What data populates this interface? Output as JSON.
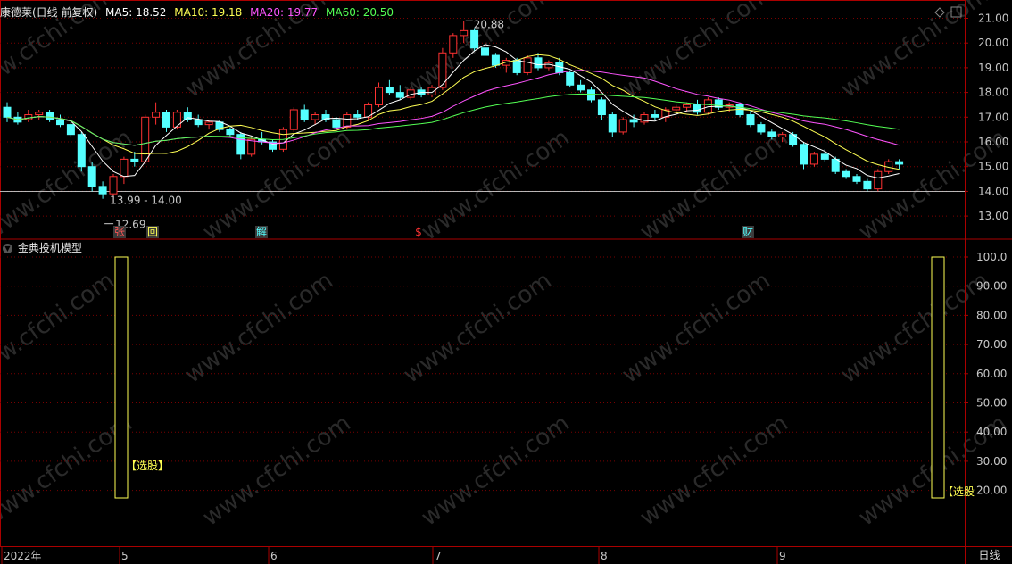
{
  "stock": {
    "title": "康德莱(日线 前复权)",
    "ma": [
      {
        "label": "MA5: 18.52",
        "color": "#ffffff"
      },
      {
        "label": "MA10: 19.18",
        "color": "#ffff54"
      },
      {
        "label": "MA20: 19.77",
        "color": "#ff54ff"
      },
      {
        "label": "MA60: 20.50",
        "color": "#54ff54"
      }
    ]
  },
  "indicator": {
    "title": "金典投机模型",
    "signal_label": "【选股】",
    "signal_label_right": "【选股"
  },
  "price_axis": {
    "ticks": [
      "21.00",
      "20.00",
      "19.00",
      "18.00",
      "17.00",
      "16.00",
      "15.00",
      "14.00",
      "13.00"
    ]
  },
  "indicator_axis": {
    "ticks": [
      "100.0",
      "90.00",
      "80.00",
      "70.00",
      "60.00",
      "50.00",
      "40.00",
      "30.00",
      "20.00"
    ]
  },
  "annotations": {
    "high": "20.88",
    "low": "12.69",
    "band": "13.99 - 14.00"
  },
  "markers": [
    {
      "label": "张",
      "color": "#ff5555",
      "bg": "#3a3a3a"
    },
    {
      "label": "回",
      "color": "#ffff54",
      "bg": "#3a3a3a"
    },
    {
      "label": "解",
      "color": "#54ffff",
      "bg": "#3a3a3a"
    },
    {
      "label": "$",
      "color": "#ff3333",
      "bg": "none"
    },
    {
      "label": "财",
      "color": "#54ffff",
      "bg": "#3a3a3a"
    }
  ],
  "time_axis": {
    "labels": [
      "2022年",
      "5",
      "6",
      "7",
      "8",
      "9"
    ],
    "period_tab": "日线"
  },
  "watermark": "www.cfchi.com",
  "colors": {
    "up": "#ff3232",
    "down": "#54ffff",
    "grid": "#7a0000",
    "border": "#aa0000",
    "axis_text": "#c8c8c8"
  },
  "chart_data": {
    "type": "candlestick",
    "ylim": [
      12.2,
      21.4
    ],
    "candles": [
      [
        17.4,
        17.6,
        16.8,
        17.0
      ],
      [
        17.0,
        17.2,
        16.7,
        16.8
      ],
      [
        16.9,
        17.3,
        16.8,
        17.1
      ],
      [
        17.1,
        17.3,
        16.9,
        17.2
      ],
      [
        17.2,
        17.3,
        16.8,
        16.9
      ],
      [
        16.9,
        17.1,
        16.6,
        16.7
      ],
      [
        16.7,
        16.8,
        16.2,
        16.3
      ],
      [
        16.3,
        16.4,
        14.8,
        15.0
      ],
      [
        15.0,
        15.2,
        14.0,
        14.2
      ],
      [
        14.2,
        14.4,
        13.7,
        13.9
      ],
      [
        13.9,
        14.7,
        13.5,
        14.6
      ],
      [
        14.6,
        15.4,
        14.3,
        15.3
      ],
      [
        15.3,
        15.6,
        15.0,
        15.2
      ],
      [
        15.2,
        17.1,
        15.1,
        17.0
      ],
      [
        17.0,
        17.6,
        16.7,
        17.2
      ],
      [
        17.2,
        17.3,
        16.4,
        16.6
      ],
      [
        16.6,
        17.3,
        16.5,
        17.2
      ],
      [
        17.2,
        17.4,
        16.8,
        16.9
      ],
      [
        16.9,
        17.1,
        16.6,
        16.7
      ],
      [
        16.7,
        16.9,
        16.5,
        16.8
      ],
      [
        16.8,
        16.9,
        16.4,
        16.5
      ],
      [
        16.5,
        16.6,
        16.2,
        16.3
      ],
      [
        16.3,
        16.4,
        15.3,
        15.5
      ],
      [
        15.5,
        16.2,
        15.4,
        16.1
      ],
      [
        16.1,
        16.4,
        15.9,
        16.0
      ],
      [
        16.0,
        16.1,
        15.6,
        15.7
      ],
      [
        15.7,
        16.6,
        15.6,
        16.5
      ],
      [
        16.5,
        17.4,
        16.4,
        17.3
      ],
      [
        17.3,
        17.5,
        16.8,
        16.9
      ],
      [
        16.9,
        17.2,
        16.7,
        17.1
      ],
      [
        17.1,
        17.3,
        16.8,
        16.9
      ],
      [
        16.9,
        17.0,
        16.5,
        16.6
      ],
      [
        16.6,
        17.2,
        16.5,
        17.1
      ],
      [
        17.1,
        17.3,
        16.9,
        17.0
      ],
      [
        17.0,
        17.6,
        16.9,
        17.5
      ],
      [
        17.5,
        18.4,
        17.4,
        18.2
      ],
      [
        18.2,
        18.5,
        17.9,
        18.0
      ],
      [
        18.0,
        18.3,
        17.7,
        17.8
      ],
      [
        17.8,
        18.2,
        17.7,
        18.1
      ],
      [
        18.1,
        18.2,
        17.8,
        17.9
      ],
      [
        17.9,
        18.3,
        17.8,
        18.2
      ],
      [
        18.2,
        19.8,
        18.1,
        19.6
      ],
      [
        19.6,
        20.4,
        19.4,
        20.3
      ],
      [
        20.3,
        20.9,
        20.0,
        20.5
      ],
      [
        20.5,
        20.6,
        19.7,
        19.8
      ],
      [
        19.8,
        20.0,
        19.3,
        19.5
      ],
      [
        19.5,
        19.6,
        19.0,
        19.1
      ],
      [
        19.1,
        19.4,
        18.8,
        19.3
      ],
      [
        19.3,
        19.4,
        18.7,
        18.8
      ],
      [
        18.8,
        19.5,
        18.7,
        19.4
      ],
      [
        19.4,
        19.6,
        18.9,
        19.0
      ],
      [
        19.0,
        19.3,
        18.9,
        19.2
      ],
      [
        19.2,
        19.4,
        18.7,
        18.8
      ],
      [
        18.8,
        18.9,
        18.2,
        18.3
      ],
      [
        18.3,
        18.5,
        18.0,
        18.1
      ],
      [
        18.1,
        18.2,
        17.6,
        17.7
      ],
      [
        17.7,
        17.8,
        16.9,
        17.1
      ],
      [
        17.1,
        17.2,
        16.2,
        16.4
      ],
      [
        16.4,
        17.0,
        16.3,
        16.9
      ],
      [
        16.9,
        17.1,
        16.6,
        16.8
      ],
      [
        16.8,
        17.2,
        16.7,
        17.1
      ],
      [
        17.1,
        17.3,
        16.9,
        17.0
      ],
      [
        17.0,
        17.4,
        16.8,
        17.3
      ],
      [
        17.3,
        17.5,
        17.1,
        17.4
      ],
      [
        17.4,
        17.6,
        17.2,
        17.5
      ],
      [
        17.5,
        17.7,
        17.1,
        17.2
      ],
      [
        17.2,
        17.8,
        17.1,
        17.7
      ],
      [
        17.7,
        17.8,
        17.3,
        17.4
      ],
      [
        17.4,
        17.6,
        17.2,
        17.5
      ],
      [
        17.5,
        17.6,
        17.0,
        17.1
      ],
      [
        17.1,
        17.3,
        16.6,
        16.7
      ],
      [
        16.7,
        16.8,
        16.3,
        16.4
      ],
      [
        16.4,
        16.5,
        16.1,
        16.2
      ],
      [
        16.2,
        16.4,
        16.0,
        16.3
      ],
      [
        16.3,
        16.4,
        15.8,
        15.9
      ],
      [
        15.9,
        16.0,
        14.9,
        15.1
      ],
      [
        15.1,
        15.6,
        15.0,
        15.5
      ],
      [
        15.5,
        15.7,
        15.2,
        15.3
      ],
      [
        15.3,
        15.4,
        14.7,
        14.8
      ],
      [
        14.8,
        14.9,
        14.5,
        14.6
      ],
      [
        14.6,
        14.7,
        14.3,
        14.4
      ],
      [
        14.4,
        14.5,
        14.0,
        14.1
      ],
      [
        14.1,
        14.9,
        14.0,
        14.8
      ],
      [
        14.8,
        15.3,
        14.7,
        15.2
      ],
      [
        15.2,
        15.3,
        14.9,
        15.1
      ]
    ],
    "signal_bars": [
      {
        "position": "left",
        "value": 100
      },
      {
        "position": "right",
        "value": 100
      }
    ]
  }
}
